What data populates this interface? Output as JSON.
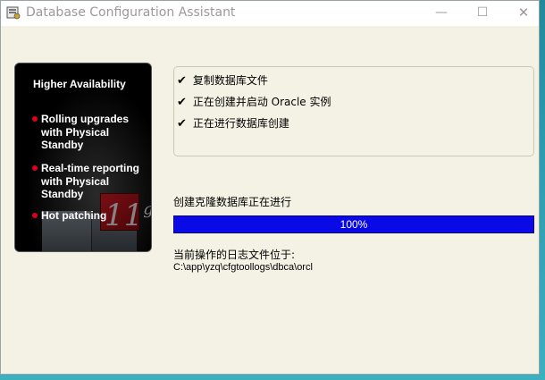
{
  "window": {
    "title": "Database Configuration Assistant",
    "controls": {
      "minimize": "—",
      "maximize": "☐",
      "close": "✕"
    }
  },
  "banner": {
    "title": "Higher Availability",
    "bullets": [
      "Rolling upgrades with Physical Standby",
      "Real-time reporting with Physical Standby",
      "Hot patching"
    ],
    "logo": "11",
    "logo_suffix": "g"
  },
  "steps": [
    {
      "check": "✔",
      "label": "复制数据库文件"
    },
    {
      "check": "✔",
      "label": "正在创建并启动 Oracle 实例"
    },
    {
      "check": "✔",
      "label": "正在进行数据库创建"
    }
  ],
  "progress": {
    "label": "创建克隆数据库正在进行",
    "percent_text": "100%",
    "value": 1.0,
    "bar_color": "#0a0ae6"
  },
  "log": {
    "label": "当前操作的日志文件位于:",
    "path": "C:\\app\\yzq\\cfgtoollogs\\dbca\\orcl"
  }
}
